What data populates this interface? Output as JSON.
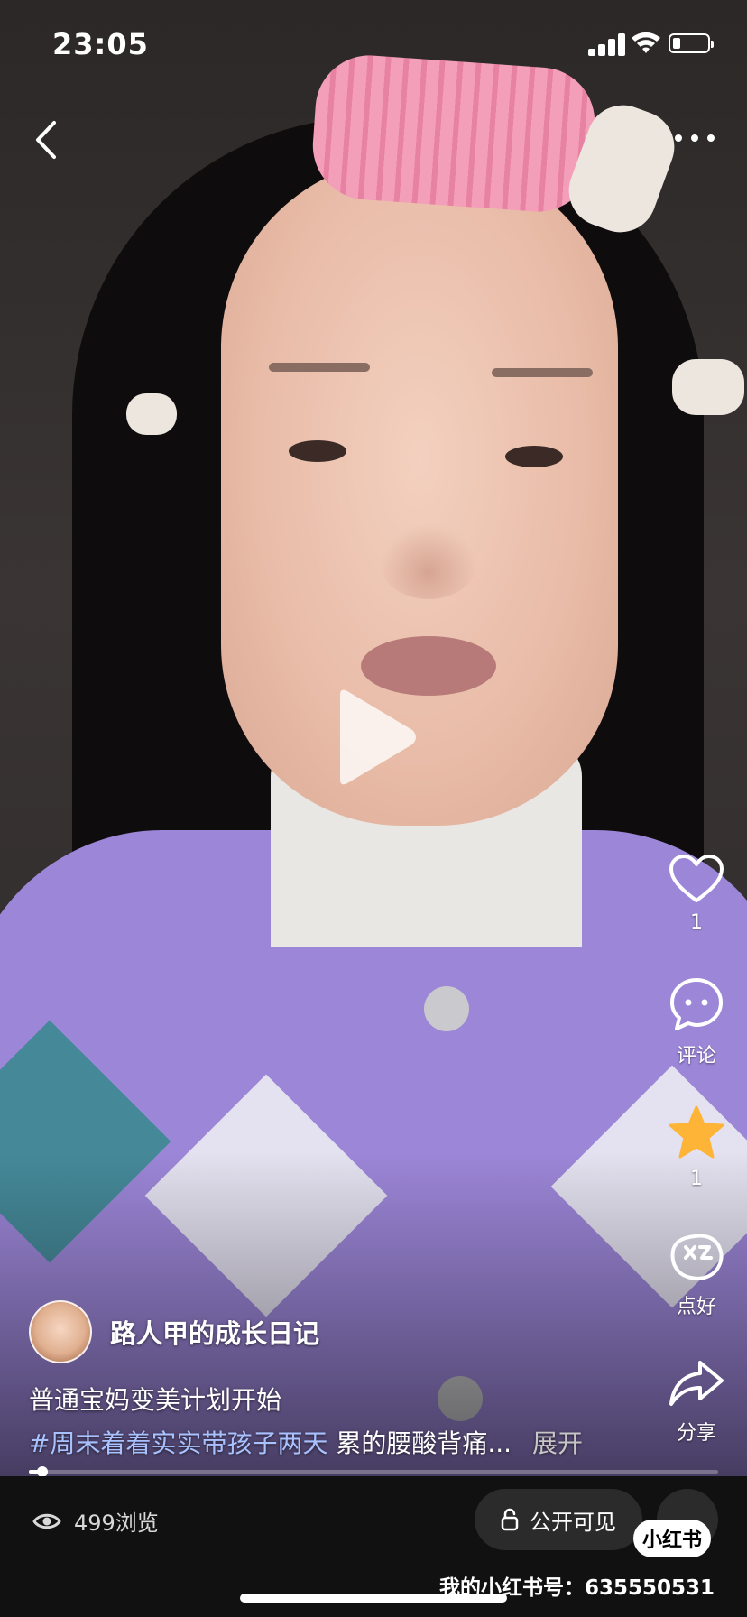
{
  "status_bar": {
    "time": "23:05",
    "battery_level": 0.2
  },
  "nav": {
    "back_icon": "chevron-left-icon",
    "more_icon": "more-dots-icon"
  },
  "video": {
    "play_icon": "play-icon",
    "progress": 0.02
  },
  "actions": {
    "like": {
      "icon": "heart-icon",
      "count": "1"
    },
    "comment": {
      "icon": "comment-icon",
      "label": "评论"
    },
    "collect": {
      "icon": "star-icon",
      "count": "1",
      "color": "#FDB437"
    },
    "good": {
      "icon": "good-badge-icon",
      "label": "点好"
    },
    "share": {
      "icon": "share-arrow-icon",
      "label": "分享"
    }
  },
  "author": {
    "name": "路人甲的成长日记",
    "avatar_icon": "avatar"
  },
  "post": {
    "title": "普通宝妈变美计划开始",
    "hashtag": "#周末着着实实带孩子两天",
    "description": "累的腰酸背痛...",
    "expand_label": "展开"
  },
  "footer": {
    "views": "499浏览",
    "visibility": "公开可见",
    "logo_text": "小红书",
    "watermark": "我的小红书号：635550531"
  },
  "colors": {
    "tag_blue": "#A9C2FF",
    "star_yellow": "#FDB437",
    "bottom_bg": "#111111"
  }
}
